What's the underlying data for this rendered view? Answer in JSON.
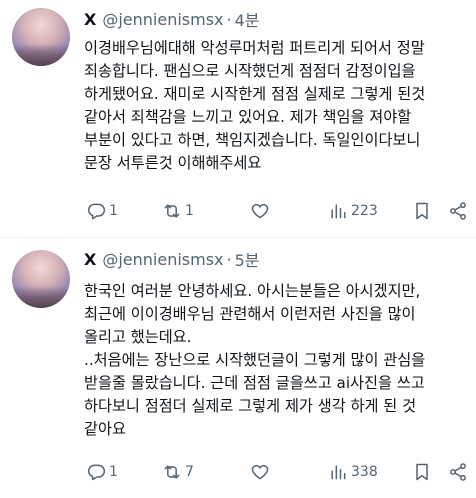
{
  "tweets": [
    {
      "author_name": "X",
      "handle": "@jennienismsx",
      "separator": "·",
      "time": "4분",
      "text": "이경배우님에대해 악성루머처럼 퍼트리게 되어서 정말\n죄송합니다. 팬심으로 시작했던게 점점더 감정이입을\n하게됐어요. 재미로 시작한게 점점 실제로 그렇게 된것\n같아서 죄책감을 느끼고 있어요. 제가 책임을 져야할\n부분이 있다고 하면, 책임지겠습니다. 독일인이다보니\n문장 서투른것 이해해주세요",
      "reply_count": "1",
      "retweet_count": "1",
      "like_count": "",
      "views_count": "223"
    },
    {
      "author_name": "X",
      "handle": "@jennienismsx",
      "separator": "·",
      "time": "5분",
      "text": "한국인 여러분 안녕하세요. 아시는분들은 아시겠지만,\n최근에 이이경배우님 관련해서 이런저런 사진을 많이\n올리고 했는데요.\n..처음에는 장난으로 시작했던글이 그렇게 많이 관심을\n받을줄 몰랐습니다. 근데 점점 글을쓰고 ai사진을 쓰고\n하다보니 점점더 실제로 그렇게 제가 생각 하게 된 것\n같아요",
      "reply_count": "1",
      "retweet_count": "7",
      "like_count": "",
      "views_count": "338"
    }
  ],
  "icons": {
    "reply": "reply-icon",
    "retweet": "retweet-icon",
    "like": "heart-icon",
    "views": "views-icon",
    "bookmark": "bookmark-icon",
    "share": "share-icon"
  },
  "colors": {
    "text": "#0f1419",
    "secondary": "#536471",
    "divider": "#eff3f4"
  }
}
